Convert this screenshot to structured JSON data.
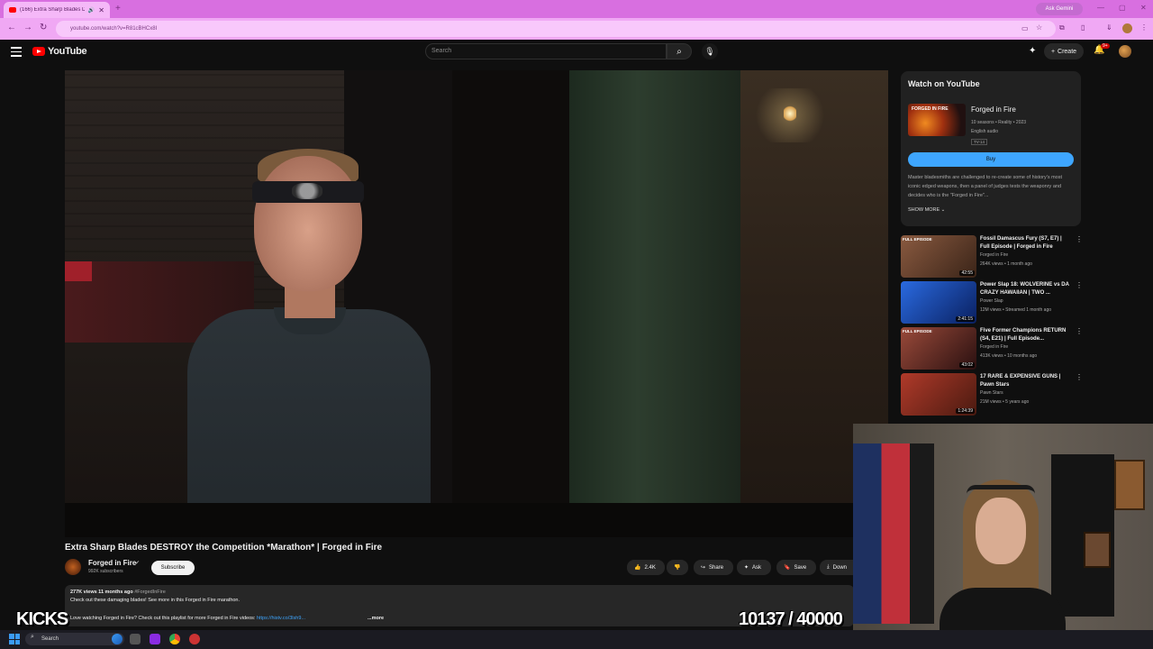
{
  "browser": {
    "tab_title": "(166) Extra Sharp Blades DE...",
    "new_tab": "+",
    "ask_gemini": "Ask Gemini",
    "url": "youtube.com/watch?v=R81cBHCx8I",
    "window_controls": [
      "—",
      "▢",
      "✕"
    ]
  },
  "header": {
    "logo_text": "YouTube",
    "search_placeholder": "Search",
    "create_label": "Create",
    "notification_count": "9+"
  },
  "video": {
    "title": "Extra Sharp Blades DESTROY the Competition *Marathon* | Forged in Fire",
    "channel": "Forged in Fire",
    "subscribers": "992K subscribers",
    "subscribe_label": "Subscribe",
    "likes": "2.4K",
    "share_label": "Share",
    "ask_label": "Ask",
    "save_label": "Save",
    "download_label": "Down",
    "views_time": "277K views  11 months ago",
    "hashtag": "#ForgedInFire",
    "desc_line1": "Check out these damaging blades! See more in this Forged in Fire marathon.",
    "desc_line2": "Love watching Forged in Fire? Check out this playlist for more Forged in Fire videos:",
    "desc_link": "https://histv.co/3lsh9...",
    "more_label": "...more"
  },
  "watch_card": {
    "heading": "Watch on YouTube",
    "thumb_label": "FORGED IN FIRE",
    "show_title": "Forged in Fire",
    "meta1": "10 seasons • Reality • 2023",
    "meta2": "English audio",
    "rating": "TV-14",
    "buy_label": "Buy",
    "description": "Master bladesmiths are challenged to re-create some of history's most iconic edged weapons, then a panel of judges tests the weaponry and decides who is the \"Forged in Fire\"...",
    "show_more": "SHOW MORE"
  },
  "recommendations": [
    {
      "label": "FULL EPISODE",
      "title": "Fossil Damascus Fury (S7, E7) | Full Episode | Forged in Fire",
      "channel": "Forged in Fire",
      "views": "264K views • 1 month ago",
      "duration": "42:55",
      "color": "#5a3a28"
    },
    {
      "label": "",
      "title": "Power Slap 18: WOLVERINE vs DA CRAZY HAWAIIAN | TWO ...",
      "channel": "Power Slap",
      "views": "12M views • Streamed 1 month ago",
      "duration": "2:41:15",
      "color": "#1a4aa0"
    },
    {
      "label": "FULL EPISODE",
      "title": "Five Former Champions RETURN (S4, E21) | Full Episode...",
      "channel": "Forged in Fire",
      "views": "413K views • 10 months ago",
      "duration": "43:02",
      "color": "#6a3030"
    },
    {
      "label": "",
      "title": "17 RARE & EXPENSIVE GUNS | Pawn Stars",
      "channel": "Pawn Stars",
      "views": "21M views • 5 years ago",
      "duration": "1:24:39",
      "color": "#7a2a20"
    }
  ],
  "overlay": {
    "kicks": "KICKS",
    "counter": "10137 / 40000"
  },
  "taskbar": {
    "search_label": "Search"
  }
}
